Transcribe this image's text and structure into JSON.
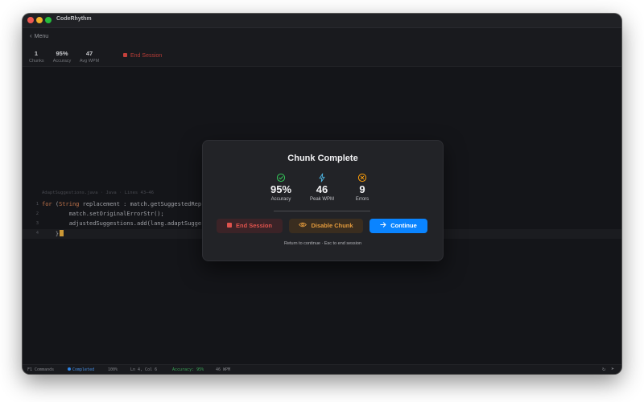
{
  "window": {
    "title": "CodeRhythm"
  },
  "menu": {
    "back_label": "Menu"
  },
  "stats": [
    {
      "value": "1",
      "label": "Chunks"
    },
    {
      "value": "95%",
      "label": "Accuracy"
    },
    {
      "value": "47",
      "label": "Avg WPM"
    }
  ],
  "end_session_top": "End Session",
  "editor": {
    "file_label": "AdaptSuggestions.java · Java · Lines 43–46",
    "lines": [
      {
        "num": "1",
        "keyword": "for",
        "paren": " (",
        "type": "String",
        "rest": " replacement : match.getSuggestedRep"
      },
      {
        "num": "2",
        "text": "        match.setOriginalErrorStr();"
      },
      {
        "num": "3",
        "text": "        adjustedSuggestions.add(lang.adaptSugge"
      },
      {
        "num": "4",
        "text": "    }"
      }
    ]
  },
  "modal": {
    "title": "Chunk Complete",
    "stats": [
      {
        "value": "95%",
        "label": "Accuracy",
        "icon": "check-circle-icon",
        "color": "#34c759"
      },
      {
        "value": "46",
        "label": "Peak WPM",
        "icon": "lightning-icon",
        "color": "#4fb8e6"
      },
      {
        "value": "9",
        "label": "Errors",
        "icon": "x-circle-icon",
        "color": "#ff9f0a"
      }
    ],
    "buttons": {
      "end_session": "End Session",
      "disable_chunk": "Disable Chunk",
      "continue": "Continue"
    },
    "hint": "Return to continue · Esc to end session"
  },
  "statusbar": {
    "commands": "F1 Commands",
    "state": "Completed",
    "zoom": "100%",
    "position": "Ln 4, Col 6",
    "accuracy": "Accuracy: 95%",
    "wpm": "46 WPM"
  },
  "colors": {
    "accent": "#0a84ff",
    "danger": "#e0534d",
    "warning": "#e39a3c",
    "success": "#34c759"
  }
}
